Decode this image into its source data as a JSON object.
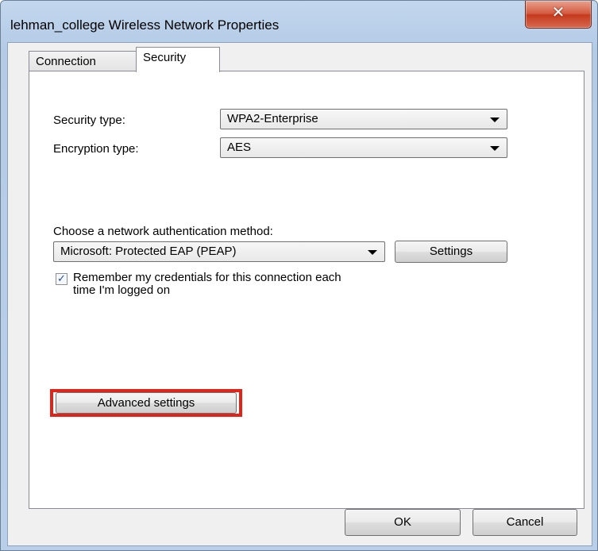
{
  "window": {
    "title": "lehman_college Wireless Network Properties",
    "close_glyph": "✕"
  },
  "tabs": [
    {
      "label": "Connection",
      "active": false
    },
    {
      "label": "Security",
      "active": true
    }
  ],
  "security": {
    "security_type_label": "Security type:",
    "security_type_value": "WPA2-Enterprise",
    "encryption_type_label": "Encryption type:",
    "encryption_type_value": "AES",
    "auth_method_label": "Choose a network authentication method:",
    "auth_method_value": "Microsoft: Protected EAP (PEAP)",
    "settings_label": "Settings",
    "remember_checked": true,
    "remember_check_glyph": "✓",
    "remember_label_line1": "Remember my credentials for this connection each",
    "remember_label_line2": "time I'm logged on",
    "advanced_label": "Advanced settings"
  },
  "footer": {
    "ok_label": "OK",
    "cancel_label": "Cancel"
  },
  "colors": {
    "highlight_box": "#e2231a",
    "title_bar": "#b9cfe9",
    "close_button": "#c43a1d"
  }
}
